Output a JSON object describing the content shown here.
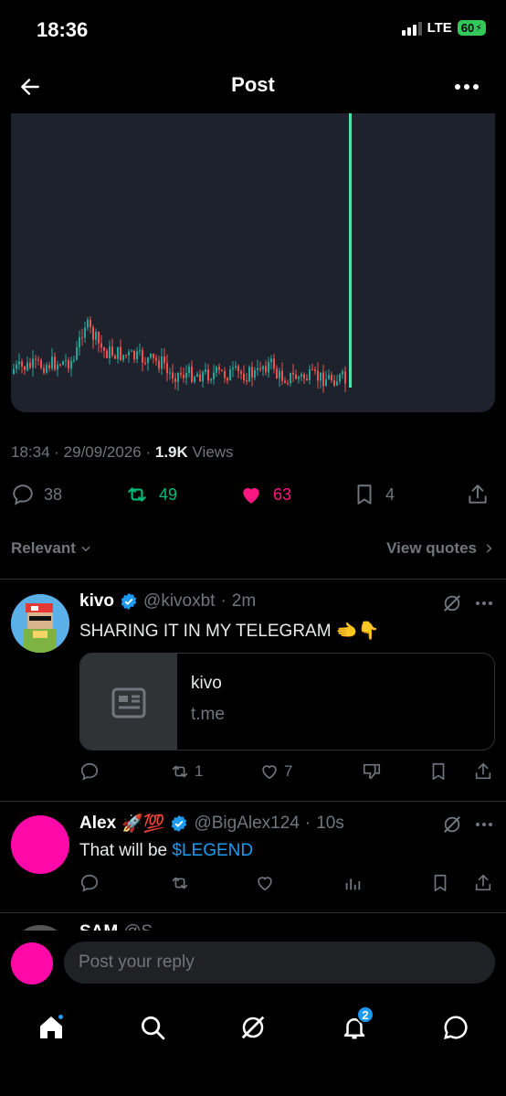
{
  "status": {
    "time": "18:36",
    "network": "LTE",
    "battery": "60"
  },
  "header": {
    "title": "Post"
  },
  "post": {
    "time": "18:34",
    "date": "29/09/2026",
    "views_count": "1.9K",
    "views_label": "Views",
    "replies": "38",
    "reposts": "49",
    "likes": "63",
    "bookmarks": "4",
    "chart_image": "candlestick-price-chart"
  },
  "sort": {
    "label": "Relevant",
    "quotes_label": "View quotes"
  },
  "replies": [
    {
      "name": "kivo",
      "handle": "@kivoxbt",
      "age": "2m",
      "text": "SHARING IT IN MY TELEGRAM",
      "emoji": "🫲👇",
      "card": {
        "title": "kivo",
        "domain": "t.me"
      },
      "reposts": "1",
      "likes": "7"
    },
    {
      "name": "Alex",
      "name_emoji": "🚀💯",
      "handle": "@BigAlex124",
      "age": "10s",
      "text": "That will be",
      "cashtag": "$LEGEND"
    },
    {
      "name": "SAM",
      "handle": "@S"
    }
  ],
  "compose": {
    "placeholder": "Post your reply"
  },
  "tabs": {
    "notifications_badge": "2"
  },
  "colors": {
    "accent": "#1d9bf0",
    "repost": "#00ba7c",
    "like": "#f91880",
    "chart_up": "#26a69a",
    "chart_down": "#ef5350"
  }
}
